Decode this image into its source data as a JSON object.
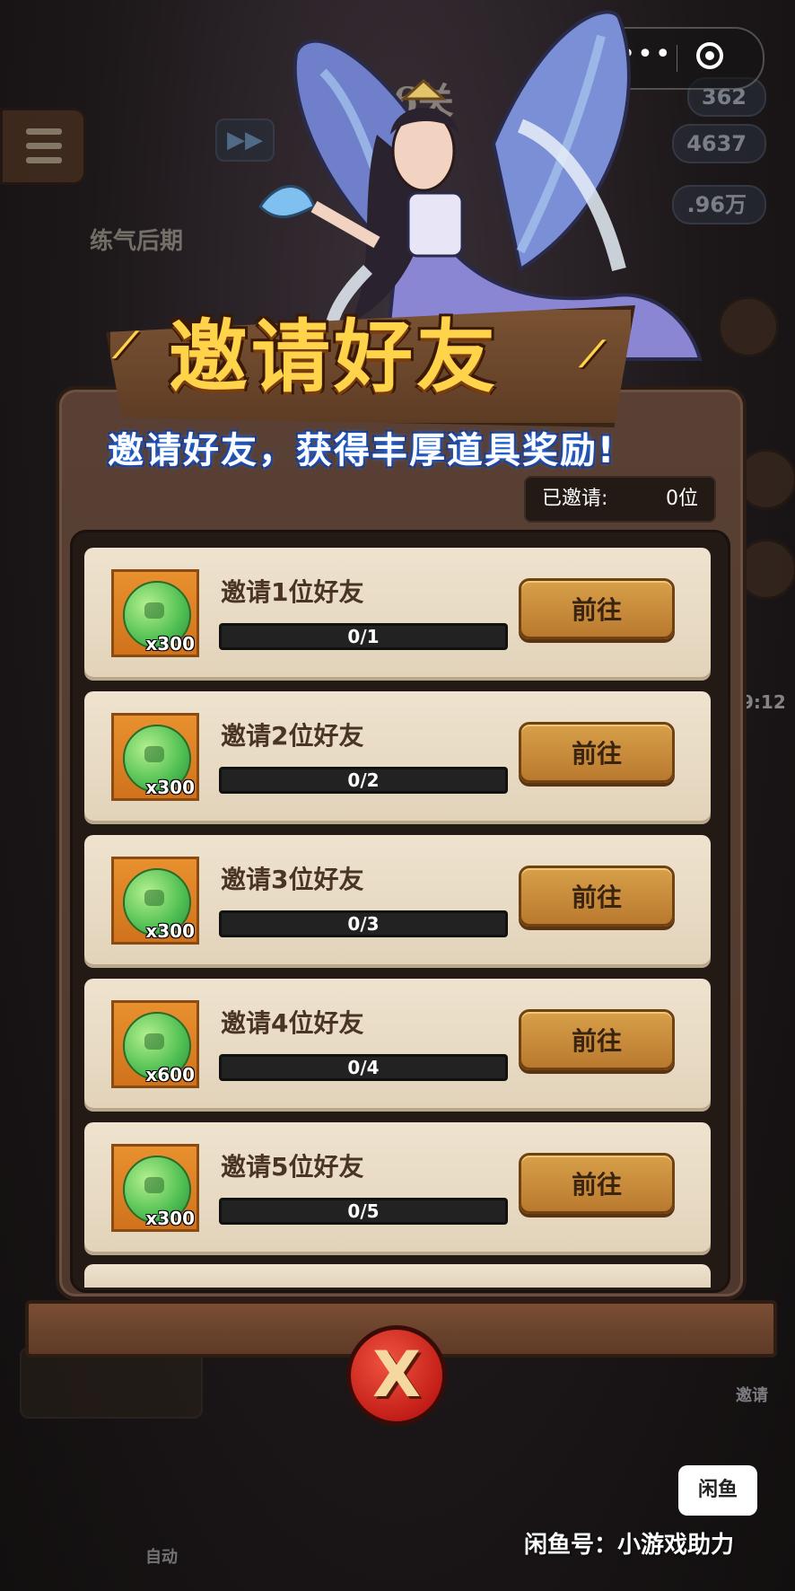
{
  "hud": {
    "level": "第66关",
    "stage_name": "练气后期",
    "resources": [
      "362",
      "4637",
      ".96万"
    ],
    "side_time": "9:12",
    "invite_side_label": "邀请",
    "auto_label": "自动"
  },
  "popup": {
    "title": "邀请好友",
    "subtitle": "邀请好友，获得丰厚道具奖励!",
    "invited_label": "已邀请:",
    "invited_value": "0位"
  },
  "tasks": [
    {
      "label": "邀请1位好友",
      "reward_qty": "x300",
      "progress_text": "0/1",
      "progress": 0,
      "button": "前往"
    },
    {
      "label": "邀请2位好友",
      "reward_qty": "x300",
      "progress_text": "0/2",
      "progress": 0,
      "button": "前往"
    },
    {
      "label": "邀请3位好友",
      "reward_qty": "x300",
      "progress_text": "0/3",
      "progress": 0,
      "button": "前往"
    },
    {
      "label": "邀请4位好友",
      "reward_qty": "x600",
      "progress_text": "0/4",
      "progress": 0,
      "button": "前往"
    },
    {
      "label": "邀请5位好友",
      "reward_qty": "x300",
      "progress_text": "0/5",
      "progress": 0,
      "button": "前往"
    }
  ],
  "close_glyph": "X",
  "watermark": "闲鱼号：小游戏助力",
  "icons": {
    "menu": "menu-icon",
    "fast_forward": "fast-forward-icon",
    "capsule_more": "more-dots-icon",
    "capsule_close": "target-circle-icon",
    "reward": "green-jade-icon",
    "close": "close-x-icon"
  },
  "colors": {
    "title": "#ffd34a",
    "button": "#c98a3a",
    "close_button": "#d42a20",
    "row_bg": "#eadcc4"
  }
}
